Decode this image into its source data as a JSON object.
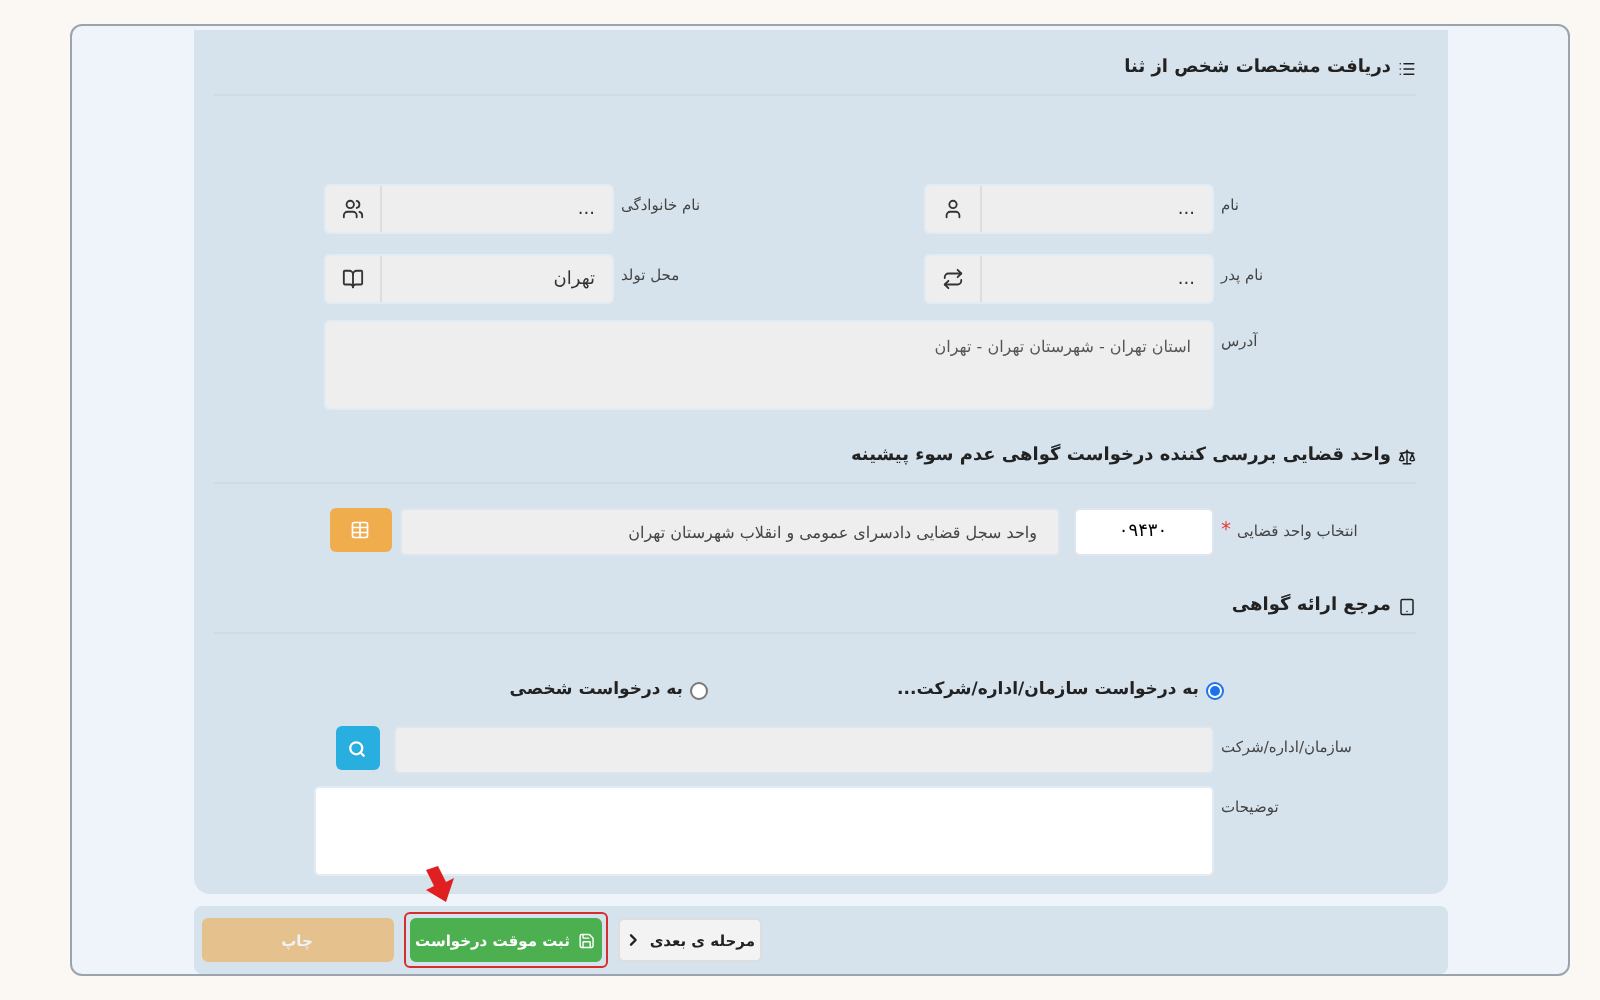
{
  "person_section": {
    "title": "دریافت مشخصات شخص از ثنا",
    "fields": [
      {
        "label": "نام",
        "value": "..."
      },
      {
        "label": "نام خانوادگی",
        "value": "..."
      },
      {
        "label": "نام پدر",
        "value": "..."
      },
      {
        "label": "محل تولد",
        "value": "تهران"
      }
    ],
    "address": {
      "label": "آدرس",
      "value": "استان تهران - شهرستان تهران - تهران"
    }
  },
  "court_section": {
    "title": "واحد قضایی بررسی کننده درخواست گواهی عدم سوء پیشینه",
    "field": {
      "label": "انتخاب واحد قضایی",
      "required_mark": "*",
      "code": "۰۹۴۳۰",
      "value": "واحد سجل قضایی دادسرای عمومی و انقلاب شهرستان تهران"
    }
  },
  "reference_section": {
    "title": "مرجع ارائه گواهی",
    "options": [
      {
        "label": "به درخواست سازمان/اداره/شرکت...",
        "selected": true
      },
      {
        "label": "به درخواست شخصی",
        "selected": false
      }
    ],
    "organization": {
      "label": "سازمان/اداره/شرکت"
    },
    "description": {
      "label": "توضیحات"
    }
  },
  "footer_buttons": [
    {
      "label": "مرحله ی بعدی",
      "kind": "next",
      "highlighted": false,
      "disabled": false
    },
    {
      "label": "ثبت موقت درخواست",
      "kind": "save",
      "highlighted": true,
      "disabled": false
    },
    {
      "label": "چاپ",
      "kind": "print",
      "highlighted": false,
      "disabled": true
    }
  ]
}
